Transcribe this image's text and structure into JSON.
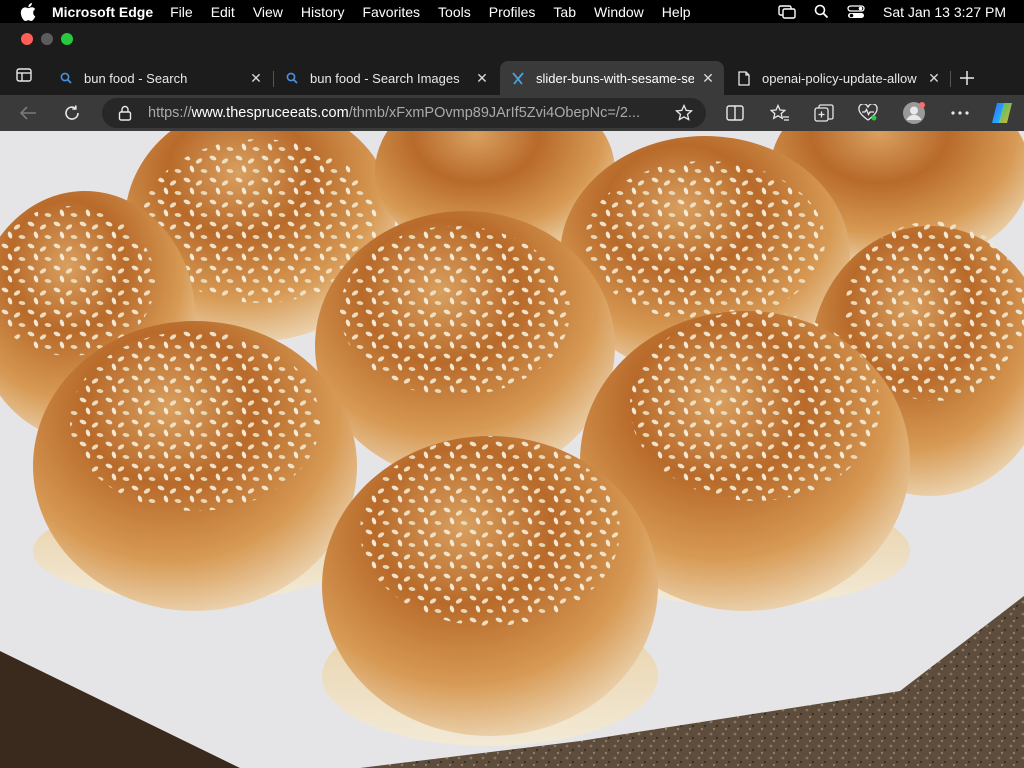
{
  "menubar": {
    "apple_icon": "apple-icon",
    "app_name": "Microsoft Edge",
    "items": [
      "File",
      "Edit",
      "View",
      "History",
      "Favorites",
      "Tools",
      "Profiles",
      "Tab",
      "Window",
      "Help"
    ],
    "clock": "Sat Jan 13  3:27 PM",
    "status_icons": [
      "screen-mirroring-icon",
      "spotlight-search-icon",
      "control-center-icon"
    ]
  },
  "tabs": [
    {
      "title": "bun food - Search",
      "icon": "search-favicon-icon",
      "active": false
    },
    {
      "title": "bun food - Search Images",
      "icon": "search-favicon-icon",
      "active": false
    },
    {
      "title": "slider-buns-with-sesame-seeds",
      "icon": "spruce-eats-favicon-icon",
      "active": true
    },
    {
      "title": "openai-policy-update-allow",
      "icon": "document-favicon-icon",
      "active": false
    }
  ],
  "address_bar": {
    "scheme": "https://",
    "host": "www.thespruceeats.com",
    "path": "/thmb/xFxmPOvmp89JArIf5Zvi4ObepNc=/2..."
  },
  "colors": {
    "menubar_bg": "#000000",
    "tabstrip_bg": "#1c1c1c",
    "toolbar_bg": "#3a3a3a",
    "address_bg": "#272727",
    "close_red": "#ff5f57",
    "maximize_green": "#28c840",
    "accent_blue": "#4a90e2"
  },
  "content": {
    "image_subject": "sesame seed burger buns on parchment paper"
  }
}
